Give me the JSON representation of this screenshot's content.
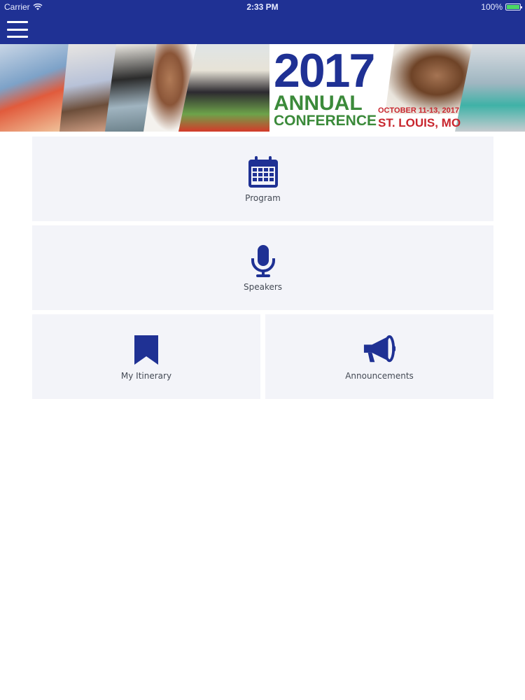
{
  "status_bar": {
    "carrier": "Carrier",
    "time": "2:33 PM",
    "battery": "100%"
  },
  "nav": {
    "menu_icon": "hamburger-menu-icon"
  },
  "banner": {
    "year": "2017",
    "annual": "ANNUAL",
    "conference": "CONFERENCE",
    "dates": "OCTOBER 11-13, 2017",
    "city": "ST. LOUIS, MO"
  },
  "tiles": {
    "program": {
      "label": "Program",
      "icon": "calendar-icon"
    },
    "speakers": {
      "label": "Speakers",
      "icon": "microphone-icon"
    },
    "itinerary": {
      "label": "My Itinerary",
      "icon": "bookmark-icon"
    },
    "announcements": {
      "label": "Announcements",
      "icon": "megaphone-icon"
    }
  },
  "colors": {
    "brand_blue": "#1f3194",
    "brand_green": "#3b8a3a",
    "brand_red": "#c8262e",
    "tile_bg": "#f3f4f9"
  }
}
